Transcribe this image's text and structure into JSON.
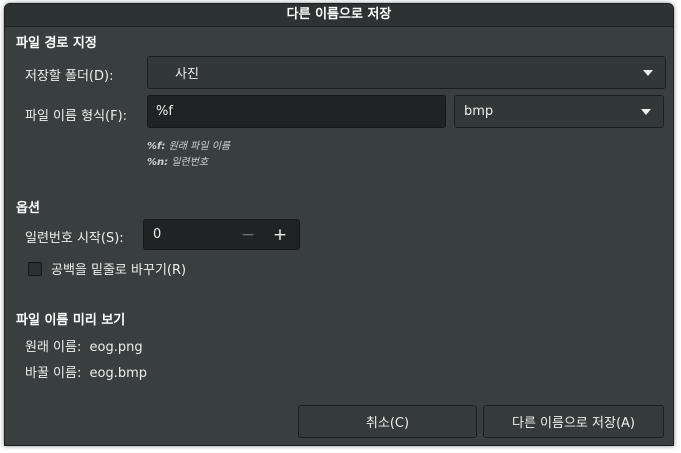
{
  "window": {
    "title": "다른 이름으로 저장"
  },
  "path_section": {
    "title": "파일 경로 지정",
    "folder_label": "저장할 폴더(D):",
    "folder_value": "사진",
    "format_label": "파일 이름 형식(F):",
    "format_value": "%f",
    "filetype_value": "bmp",
    "hint_f_token": "%f:",
    "hint_f_text": "원래 파일 이름",
    "hint_n_token": "%n:",
    "hint_n_text": "일련번호"
  },
  "options_section": {
    "title": "옵션",
    "start_label": "일련번호 시작(S):",
    "start_value": "0",
    "decrement_symbol": "−",
    "increment_symbol": "+",
    "replace_spaces_label": "공백을 밑줄로 바꾸기(R)",
    "replace_spaces_checked": false
  },
  "preview_section": {
    "title": "파일 이름 미리 보기",
    "original_label": "원래 이름:",
    "original_value": "eog.png",
    "renamed_label": "바꿀 이름:",
    "renamed_value": "eog.bmp"
  },
  "actions": {
    "cancel_label": "취소(C)",
    "save_label": "다른 이름으로 저장(A)"
  },
  "icons": {
    "combo_arrow": "chevron-down-icon"
  },
  "colors": {
    "window_bg": "#393f3f",
    "entry_bg": "#1f2323",
    "text": "#eeeeec"
  }
}
